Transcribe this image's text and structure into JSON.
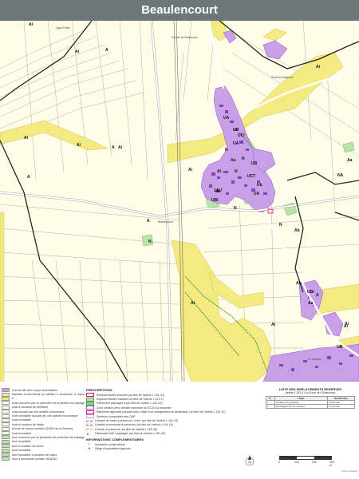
{
  "title": "Beaulencourt",
  "colors": {
    "ua": "#c9a0e8",
    "ua_dark": "#8a4fc9",
    "au": "#f3ea82",
    "nat": "#b8e6a8",
    "agri": "#fffce8",
    "road": "#ffffff",
    "parcel": "#8a8a8a",
    "commune": "#222222",
    "er": "#e6007e",
    "hedge": "#2d8a2d"
  },
  "map_labels": {
    "labels": [
      {
        "text": "Ai"
      },
      {
        "text": "Ai"
      },
      {
        "text": "Ai"
      },
      {
        "text": "Ai"
      },
      {
        "text": "Ai"
      },
      {
        "text": "Ai"
      },
      {
        "text": "Ai"
      },
      {
        "text": "Ai"
      },
      {
        "text": "Ai"
      },
      {
        "text": "Ai"
      },
      {
        "text": "Ai"
      },
      {
        "text": "Ai"
      },
      {
        "text": "A"
      },
      {
        "text": "A"
      },
      {
        "text": "A"
      },
      {
        "text": "A"
      },
      {
        "text": "A"
      },
      {
        "text": "N"
      },
      {
        "text": "N"
      },
      {
        "text": "N"
      },
      {
        "text": "N"
      },
      {
        "text": "N"
      },
      {
        "text": "N"
      },
      {
        "text": "N"
      },
      {
        "text": "UA"
      },
      {
        "text": "UA"
      },
      {
        "text": "UD"
      },
      {
        "text": "UCi"
      },
      {
        "text": "UB"
      },
      {
        "text": "1AU"
      },
      {
        "text": "UBi"
      },
      {
        "text": "UCT"
      },
      {
        "text": "Ub"
      },
      {
        "text": "Aa"
      },
      {
        "text": "Aa"
      },
      {
        "text": "Ab"
      },
      {
        "text": "Ab"
      },
      {
        "text": "Aa"
      },
      {
        "text": "NA"
      },
      {
        "text": "UBi"
      },
      {
        "text": "UB"
      },
      {
        "text": "UA"
      }
    ],
    "places": [
      {
        "text": "Beaulencourt"
      },
      {
        "text": "Ligny-Thilloy"
      },
      {
        "text": "Le Transloy"
      },
      {
        "text": "Chemin de Martinpuich"
      },
      {
        "text": "Route de Bapaume"
      }
    ]
  },
  "legend_left": [
    {
      "text": "la zone UB avec risque d'inondation",
      "color": "#c9a0e8"
    },
    {
      "text": "banisser à court terme (à: habitat / e: économie / d: équipements)",
      "color": "#f3ea82"
    },
    {
      "text": "é",
      "color": "#f3ea82"
    },
    {
      "text": "icole concerné par un périmètre de protection de captage",
      "color": "#fffce8"
    },
    {
      "text": "icole à vocation de cimetière",
      "color": "#fffce8"
    },
    {
      "text": "icole occupé par une activité économique",
      "color": "#fffce8"
    },
    {
      "text": "icole inondable occupé par une activité économique",
      "color": "#fffce8"
    },
    {
      "text": "icole inondable",
      "color": "#fffce8"
    },
    {
      "text": "icole à vocation de loisirs",
      "color": "#fffce8"
    },
    {
      "text": "rincole de zones humides (SAGE de la Sensée)",
      "color": "#fffce8"
    },
    {
      "text": "icole inondable",
      "color": "#fffce8"
    },
    {
      "text": "turel concerné par un périmètre de protection de captage",
      "color": "#b8e6a8"
    },
    {
      "text": "turel inondable",
      "color": "#b8e6a8"
    },
    {
      "text": "turel à vocation de loisirs",
      "color": "#b8e6a8"
    },
    {
      "text": "turel inondable",
      "color": "#b8e6a8"
    },
    {
      "text": "turel inondable à vocation de loisirs",
      "color": "#b8e6a8"
    },
    {
      "text": "turel à dominante humide (SDAGE)",
      "color": "#b8e6a8"
    }
  ],
  "prescriptions": {
    "heading": "PRESCRIPTIONS",
    "items": [
      {
        "text": "Emplacements réservés (au titre de l'article L.151-41)"
      },
      {
        "text": "Espaces Boisés Classés (au titre de l'article L.113-1)"
      },
      {
        "text": "Patrimoine paysager à (au titre de l'article L.151-23)"
      },
      {
        "text": "Zone urbaine avec densité minimale du SCoTA à respecter"
      },
      {
        "text": "Bâtiments agricoles pouvant faire l'objet d'un changement de destination (au titre de l'article L.151-11)"
      },
      {
        "text": "Secteurs comportant des OAP"
      },
      {
        "text": "Linéaire de haies à préserver / créer (au titre de l'article L.151-23)"
      },
      {
        "text": "Linéaire commercial à préserver (au titre de l'article L.151-16)"
      },
      {
        "text": "Chemin à préserver (au titre de l'article L.151-38)"
      },
      {
        "text": "Patrimoine bâti / paysager (au titre de l'article L.151-19)"
      }
    ]
  },
  "info": {
    "heading": "INFORMATIONS COMPLEMENTAIRES",
    "items": [
      {
        "text": "Nouvelles constructions"
      },
      {
        "text": "Siège d'exploitation agricole"
      }
    ]
  },
  "reserved": {
    "title": "LISTE DES EMPLACEMENTS RESERVES",
    "subtitle": "(article L.151-41 du Code de l'Urbanisme)",
    "headers": [
      "N°",
      "Objet",
      "Bénéficiaire"
    ],
    "rows": [
      [
        "1",
        "Création d'un parking",
        "Commune"
      ],
      [
        "2",
        "Aménagement d'un espace",
        "Commune"
      ]
    ]
  },
  "scale": {
    "ticks": [
      "0",
      "100",
      "200",
      "300 m"
    ]
  },
  "north_label": "N",
  "credit": "Fond cadastral"
}
